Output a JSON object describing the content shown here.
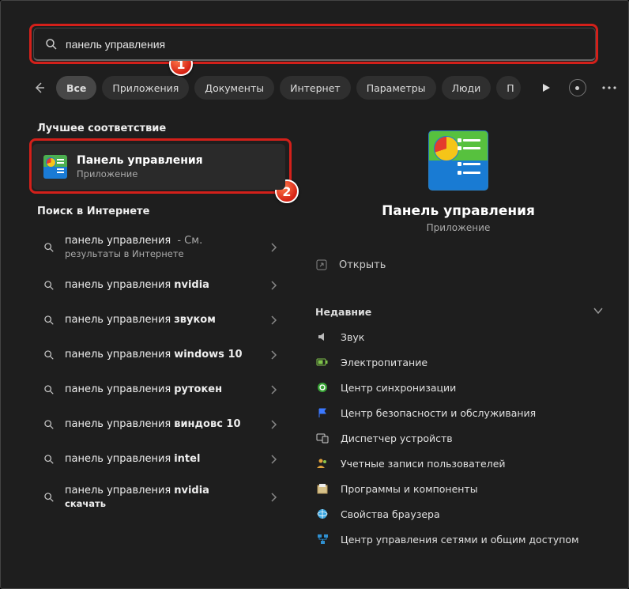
{
  "search": {
    "value": "панель управления",
    "icon": "search-icon"
  },
  "tabs": {
    "back_icon": "arrow-left-icon",
    "items": [
      "Все",
      "Приложения",
      "Документы",
      "Интернет",
      "Параметры",
      "Люди",
      "П"
    ],
    "active_index": 0
  },
  "left": {
    "best_heading": "Лучшее соответствие",
    "best": {
      "title": "Панель управления",
      "subtitle": "Приложение"
    },
    "web_heading": "Поиск в Интернете",
    "web": [
      {
        "base": "панель управления",
        "suffix": "",
        "trail": "- См.",
        "second_line": "результаты в Интернете"
      },
      {
        "base": "панель управления",
        "suffix": "nvidia"
      },
      {
        "base": "панель управления",
        "suffix": "звуком"
      },
      {
        "base": "панель управления",
        "suffix": "windows 10"
      },
      {
        "base": "панель управления",
        "suffix": "рутокен"
      },
      {
        "base": "панель управления",
        "suffix": "виндовс 10"
      },
      {
        "base": "панель управления",
        "suffix": "intel"
      },
      {
        "base": "панель управления",
        "suffix": "nvidia",
        "second_line_bold": "скачать"
      }
    ]
  },
  "right": {
    "title": "Панель управления",
    "subtitle": "Приложение",
    "open_label": "Открыть",
    "recent_heading": "Недавние",
    "recent": [
      {
        "label": "Звук",
        "icon": "speaker-icon",
        "color": "#bbb"
      },
      {
        "label": "Электропитание",
        "icon": "battery-icon",
        "color": "#6cc644"
      },
      {
        "label": "Центр синхронизации",
        "icon": "sync-icon",
        "color": "#4caf50"
      },
      {
        "label": "Центр безопасности и обслуживания",
        "icon": "flag-icon",
        "color": "#3b78ff"
      },
      {
        "label": "Диспетчер устройств",
        "icon": "devices-icon",
        "color": "#ccc"
      },
      {
        "label": "Учетные записи пользователей",
        "icon": "users-icon",
        "color": "#e2a43c"
      },
      {
        "label": "Программы и компоненты",
        "icon": "programs-icon",
        "color": "#ddd"
      },
      {
        "label": "Свойства браузера",
        "icon": "browser-icon",
        "color": "#38a5e0"
      },
      {
        "label": "Центр управления сетями и общим доступом",
        "icon": "network-icon",
        "color": "#3090d0"
      }
    ]
  }
}
